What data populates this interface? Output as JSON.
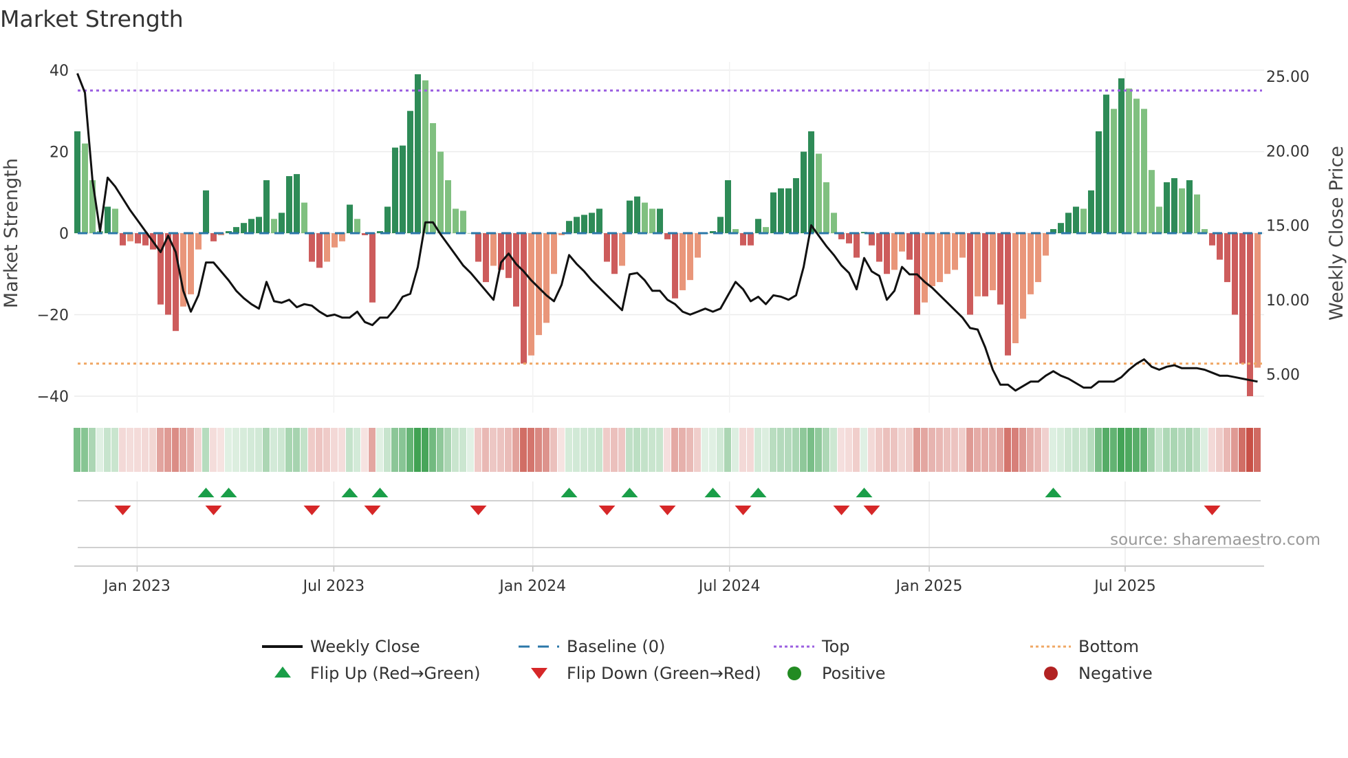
{
  "chart_data": {
    "type": "bar",
    "title": "Market Strength",
    "ylabel": "Market Strength",
    "y2label": "Weekly Close Price",
    "ylim": [
      -44,
      44
    ],
    "y2lim": [
      2.5,
      27
    ],
    "yticks": [
      {
        "v": 40,
        "label": "40"
      },
      {
        "v": 20,
        "label": "20"
      },
      {
        "v": 0,
        "label": "0"
      },
      {
        "v": -20,
        "label": "−20"
      },
      {
        "v": -40,
        "label": "−40"
      }
    ],
    "y2ticks": [
      {
        "v": 25,
        "label": "25.00"
      },
      {
        "v": 20,
        "label": "20.00"
      },
      {
        "v": 15,
        "label": "15.00"
      },
      {
        "v": 10,
        "label": "10.00"
      },
      {
        "v": 5,
        "label": "5.00"
      }
    ],
    "xticks": [
      {
        "week": 7.9,
        "label": "Jan 2023"
      },
      {
        "week": 33.9,
        "label": "Jul 2023"
      },
      {
        "week": 60.2,
        "label": "Jan 2024"
      },
      {
        "week": 86.2,
        "label": "Jul 2024"
      },
      {
        "week": 112.6,
        "label": "Jan 2025"
      },
      {
        "week": 138.5,
        "label": "Jul 2025"
      }
    ],
    "top_level": 35,
    "bottom_level": -32,
    "baseline": 0,
    "strength": [
      25,
      22,
      13,
      0.5,
      6.5,
      6,
      -3,
      -2,
      -2.5,
      -3,
      -4,
      -17.5,
      -20,
      -24,
      -18,
      -15,
      -4,
      10.5,
      -2,
      -0.5,
      0.5,
      1.5,
      2.5,
      3.5,
      4,
      13,
      3.5,
      5,
      14,
      14.5,
      7.5,
      -7,
      -8.5,
      -7,
      -3.5,
      -2,
      7,
      3.5,
      -0.5,
      -17,
      0.5,
      6.5,
      21,
      21.5,
      30,
      39,
      37.5,
      27,
      20,
      13,
      6,
      5.5,
      0,
      -7,
      -12,
      -8,
      -9,
      -11,
      -18,
      -32,
      -30,
      -25,
      -22,
      -10,
      -0.5,
      3,
      4,
      4.5,
      5,
      6,
      -7,
      -10,
      -8,
      8,
      9,
      7.5,
      6,
      6,
      -1.5,
      -16,
      -14,
      -11.5,
      -6,
      0,
      0.5,
      4,
      13,
      1,
      -3,
      -3,
      3.5,
      1.5,
      10,
      11,
      11,
      13.5,
      20,
      25,
      19.5,
      12.5,
      5,
      -1.5,
      -2.5,
      -6,
      0.3,
      -3,
      -7,
      -10,
      -9,
      -4.5,
      -6.5,
      -20,
      -17,
      -13,
      -12,
      -10,
      -9,
      -6,
      -20,
      -15.5,
      -15.5,
      -14,
      -17.5,
      -30,
      -27,
      -21,
      -15,
      -12,
      -5.5,
      1,
      2.5,
      5,
      6.5,
      6,
      10.5,
      25,
      34,
      30.5,
      38,
      35.5,
      33,
      30.5,
      15.5,
      6.5,
      12.5,
      13.5,
      11,
      13,
      9.5,
      1,
      -3,
      -6.5,
      -12,
      -20,
      -32,
      -40,
      -33
    ],
    "weekly_close": [
      25.2,
      23.9,
      18,
      14.6,
      18.2,
      17.6,
      16.8,
      16,
      15.3,
      14.6,
      13.9,
      13.2,
      14.3,
      13.2,
      10.6,
      9.2,
      10.3,
      12.5,
      12.5,
      11.9,
      11.3,
      10.6,
      10.1,
      9.7,
      9.4,
      11.2,
      9.9,
      9.8,
      10,
      9.5,
      9.7,
      9.6,
      9.2,
      8.9,
      9,
      8.8,
      8.8,
      9.2,
      8.5,
      8.3,
      8.8,
      8.8,
      9.4,
      10.2,
      10.4,
      12.2,
      15.2,
      15.2,
      14.4,
      13.7,
      13,
      12.3,
      11.8,
      11.2,
      10.6,
      10,
      12.5,
      13.1,
      12.4,
      11.9,
      11.3,
      10.8,
      10.3,
      9.9,
      11,
      13,
      12.4,
      11.9,
      11.3,
      10.8,
      10.3,
      9.8,
      9.3,
      11.7,
      11.8,
      11.3,
      10.6,
      10.6,
      10,
      9.7,
      9.2,
      9,
      9.2,
      9.4,
      9.2,
      9.4,
      10.3,
      11.2,
      10.7,
      9.9,
      10.2,
      9.7,
      10.3,
      10.2,
      10,
      10.3,
      12.2,
      15,
      14.3,
      13.6,
      13,
      12.3,
      11.8,
      10.7,
      12.8,
      11.9,
      11.6,
      10,
      10.6,
      12.2,
      11.7,
      11.7,
      11.2,
      10.8,
      10.3,
      9.8,
      9.3,
      8.8,
      8.1,
      8,
      6.8,
      5.3,
      4.3,
      4.3,
      3.9,
      4.2,
      4.5,
      4.5,
      4.9,
      5.2,
      4.9,
      4.7,
      4.4,
      4.1,
      4.1,
      4.5,
      4.5,
      4.5,
      4.8,
      5.3,
      5.7,
      6,
      5.5,
      5.3,
      5.5,
      5.6,
      5.4,
      5.4,
      5.4,
      5.3,
      5.1,
      4.9,
      4.9,
      4.8,
      4.7,
      4.6,
      4.5
    ],
    "flip_up_weeks": [
      17,
      20,
      36,
      40,
      65,
      73,
      84,
      90,
      104,
      129
    ],
    "flip_down_weeks": [
      6,
      18,
      31,
      39,
      53,
      70,
      78,
      88,
      101,
      105,
      150
    ],
    "colors": {
      "pos_rising": "#2e8b57",
      "pos_falling": "#80c080",
      "neg_falling": "#cd5c5c",
      "neg_rising": "#e9967a",
      "close": "#111111",
      "baseline": "#2b77a8",
      "top": "#9b5fe0",
      "bottom": "#f0a865",
      "flip_up": "#1a9e48",
      "flip_down": "#d62728",
      "positive": "#228b22",
      "negative": "#b22222"
    },
    "legend": [
      {
        "label": "Weekly Close",
        "kind": "line-solid",
        "color": "#111111"
      },
      {
        "label": "Baseline (0)",
        "kind": "line-dash",
        "color": "#2b77a8"
      },
      {
        "label": "Top",
        "kind": "line-dot",
        "color": "#9b5fe0"
      },
      {
        "label": "Bottom",
        "kind": "line-dot",
        "color": "#f0a865"
      },
      {
        "label": "Flip Up (Red→Green)",
        "kind": "tri-up",
        "color": "#1a9e48"
      },
      {
        "label": "Flip Down (Green→Red)",
        "kind": "tri-down",
        "color": "#d62728"
      },
      {
        "label": "Positive",
        "kind": "dot",
        "color": "#228b22"
      },
      {
        "label": "Negative",
        "kind": "dot",
        "color": "#b22222"
      }
    ],
    "legend_placement": "bottom",
    "grid": true
  },
  "source": "source: sharemaestro.com"
}
